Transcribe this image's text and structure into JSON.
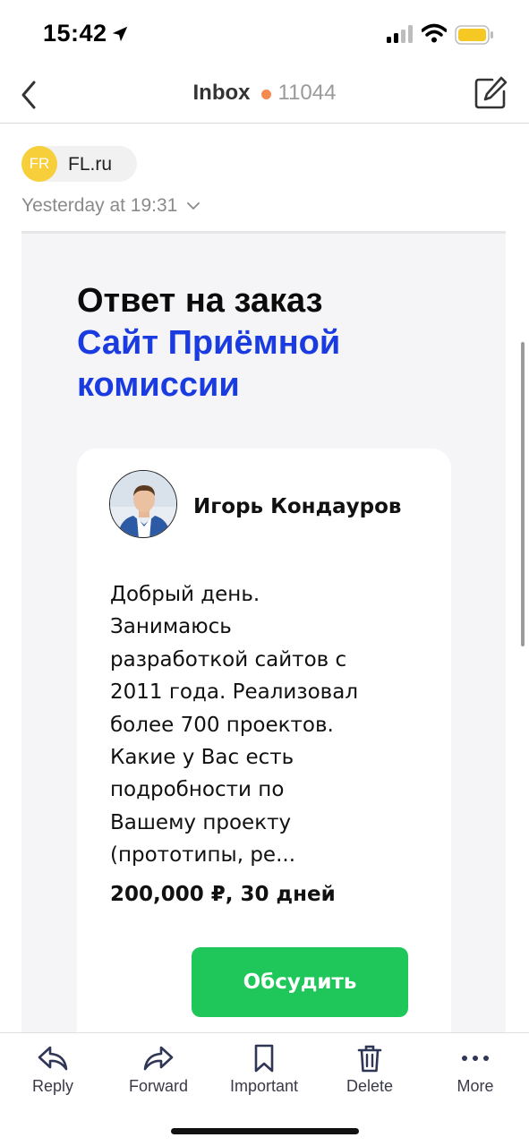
{
  "status_bar": {
    "time": "15:42"
  },
  "nav": {
    "title": "Inbox",
    "unread_count": "11044",
    "dot_color": "#f58a4e"
  },
  "sender": {
    "initials": "FR",
    "name": "FL.ru"
  },
  "date": {
    "text": "Yesterday at 19:31"
  },
  "email": {
    "title_line": "Ответ на заказ",
    "project_title": "Сайт Приёмной комиссии",
    "freelancer_name": "Игорь Кондауров",
    "message": "Добрый день.\nЗанимаюсь\nразработкой сайтов с\n2011 года. Реализовал\nболее 700 проектов.\nКакие у Вас есть\nподробности по\nВашему проекту\n(прототипы, ре...",
    "price": "200,000 ₽, 30 дней",
    "button_label": "Обсудить",
    "accent_color": "#1a3be0",
    "button_color": "#1fc75a"
  },
  "toolbar": {
    "reply": "Reply",
    "forward": "Forward",
    "important": "Important",
    "delete": "Delete",
    "more": "More"
  },
  "icons": [
    "location-arrow-icon",
    "signal-icon",
    "wifi-icon",
    "battery-icon",
    "back-chevron-icon",
    "compose-icon",
    "chevron-down-icon",
    "reply-icon",
    "forward-icon",
    "bookmark-icon",
    "trash-icon",
    "more-dots-icon"
  ]
}
